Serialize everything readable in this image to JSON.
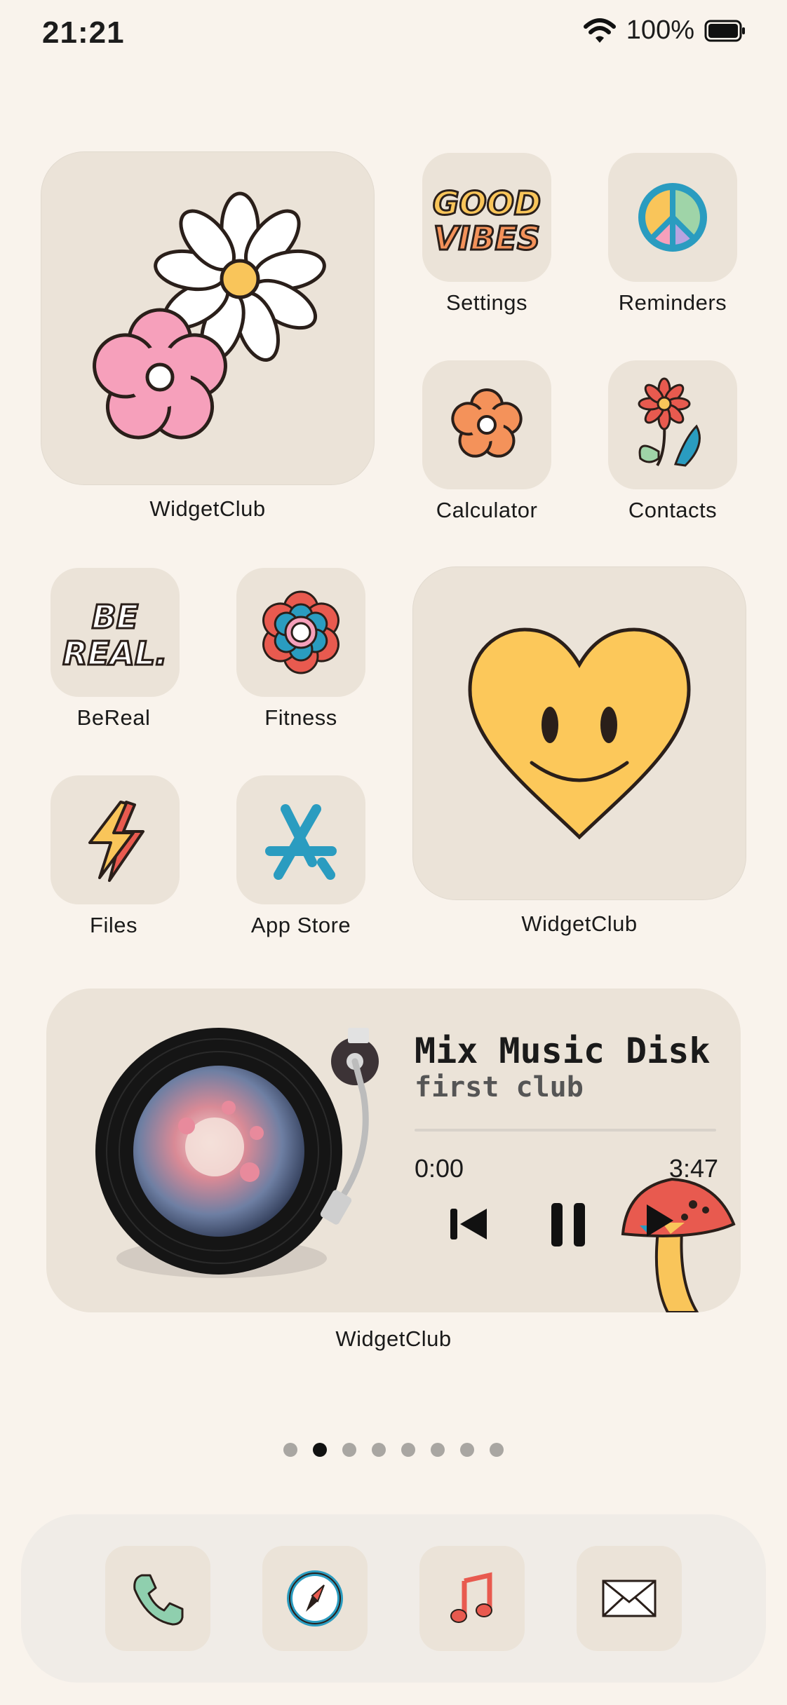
{
  "status": {
    "time": "21:21",
    "battery": "100%"
  },
  "apps": {
    "settings": "Settings",
    "reminders": "Reminders",
    "calculator": "Calculator",
    "contacts": "Contacts",
    "bereal": "BeReal",
    "fitness": "Fitness",
    "files": "Files",
    "appstore": "App Store"
  },
  "icon_text": {
    "good_vibes_1": "GOOD",
    "good_vibes_2": "VIBES",
    "bereal_1": "BE",
    "bereal_2": "REAL."
  },
  "widgets": {
    "flower_label": "WidgetClub",
    "heart_label": "WidgetClub",
    "music_label": "WidgetClub"
  },
  "music": {
    "title": "Mix Music Disk",
    "artist": "first club",
    "elapsed": "0:00",
    "duration": "3:47",
    "progress": 0
  },
  "pages": {
    "count": 8,
    "active": 2
  },
  "dock": [
    "phone-icon",
    "safari-icon",
    "music-icon",
    "mail-icon"
  ],
  "colors": {
    "background": "#f9f3ec",
    "tile": "#ebe3d8",
    "dock": "#f0ece7",
    "accent_yellow": "#f9c55a",
    "accent_pink": "#f6a0bb"
  }
}
